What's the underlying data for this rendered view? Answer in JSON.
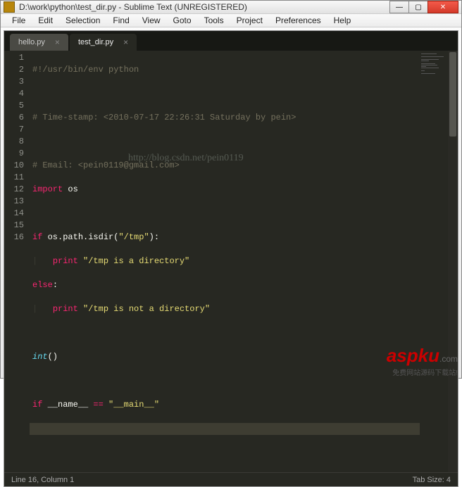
{
  "window": {
    "title": "D:\\work\\python\\test_dir.py - Sublime Text (UNREGISTERED)"
  },
  "window_controls": {
    "min": "—",
    "max": "▢",
    "close": "✕"
  },
  "menu": {
    "items": [
      "File",
      "Edit",
      "Selection",
      "Find",
      "View",
      "Goto",
      "Tools",
      "Project",
      "Preferences",
      "Help"
    ]
  },
  "tabs": [
    {
      "label": "hello.py",
      "active": false
    },
    {
      "label": "test_dir.py",
      "active": true
    }
  ],
  "code": {
    "line_numbers": [
      "1",
      "2",
      "3",
      "4",
      "5",
      "6",
      "7",
      "8",
      "9",
      "10",
      "11",
      "12",
      "13",
      "14",
      "15",
      "16"
    ],
    "tokens": {
      "l1": "#!/usr/bin/env python",
      "l3": "# Time-stamp: <2010-07-17 22:26:31 Saturday by pein>",
      "l5": "# Email: <pein0119@gmail.com>",
      "l6_import": "import",
      "l6_os": "os",
      "l8_if": "if",
      "l8_path": "os.path.isdir",
      "l8_paren_open": "(",
      "l8_str": "\"/tmp\"",
      "l8_paren_close": "):",
      "l9_print": "print",
      "l9_str": "\"/tmp is a directory\"",
      "l10_else": "else",
      "l10_colon": ":",
      "l11_print": "print",
      "l11_str": "\"/tmp is not a directory\"",
      "l13_int": "int",
      "l13_paren": "()",
      "l15_if": "if",
      "l15_name": "__name__",
      "l15_eq": "==",
      "l15_main": "\"__main__\""
    }
  },
  "watermark": "http://blog.csdn.net/pein0119",
  "statusbar": {
    "left": "Line 16, Column 1",
    "right": "Tab Size: 4"
  },
  "overlay": {
    "brand": "aspku",
    "tld": ".com",
    "sub": "免费网站源码下载站!"
  }
}
